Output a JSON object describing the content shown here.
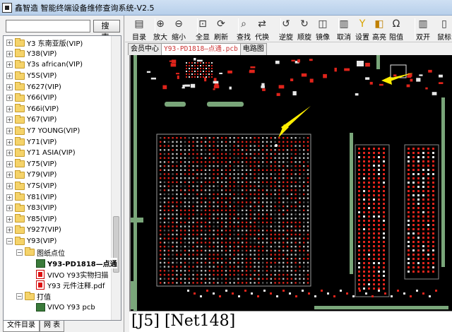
{
  "window": {
    "title": "鑫智造 智能终端设备维修查询系统-V2.5"
  },
  "search": {
    "button_label": "搜 索",
    "placeholder": ""
  },
  "tree": {
    "items": [
      {
        "label": "Y3 东南亚版(VIP)",
        "type": "folder",
        "expander": "+"
      },
      {
        "label": "Y38(VIP)",
        "type": "folder",
        "expander": "+"
      },
      {
        "label": "Y3s african(VIP)",
        "type": "folder",
        "expander": "+"
      },
      {
        "label": "Y5S(VIP)",
        "type": "folder",
        "expander": "+"
      },
      {
        "label": "Y627(VIP)",
        "type": "folder",
        "expander": "+"
      },
      {
        "label": "Y66(VIP)",
        "type": "folder",
        "expander": "+"
      },
      {
        "label": "Y66i(VIP)",
        "type": "folder",
        "expander": "+"
      },
      {
        "label": "Y67(VIP)",
        "type": "folder",
        "expander": "+"
      },
      {
        "label": "Y7 YOUNG(VIP)",
        "type": "folder",
        "expander": "+"
      },
      {
        "label": "Y71(VIP)",
        "type": "folder",
        "expander": "+"
      },
      {
        "label": "Y71 ASIA(VIP)",
        "type": "folder",
        "expander": "+"
      },
      {
        "label": "Y75(VIP)",
        "type": "folder",
        "expander": "+"
      },
      {
        "label": "Y79(VIP)",
        "type": "folder",
        "expander": "+"
      },
      {
        "label": "Y7S(VIP)",
        "type": "folder",
        "expander": "+"
      },
      {
        "label": "Y81(VIP)",
        "type": "folder",
        "expander": "+"
      },
      {
        "label": "Y83(VIP)",
        "type": "folder",
        "expander": "+"
      },
      {
        "label": "Y85(VIP)",
        "type": "folder",
        "expander": "+"
      },
      {
        "label": "Y927(VIP)",
        "type": "folder",
        "expander": "+"
      },
      {
        "label": "Y93(VIP)",
        "type": "folder",
        "expander": "−"
      },
      {
        "label": "图纸点位",
        "type": "folder",
        "expander": "−"
      },
      {
        "label": "Y93-PD1818—点通",
        "type": "pcb",
        "expander": ""
      },
      {
        "label": "VIVO Y93实物扫描",
        "type": "pdf",
        "expander": ""
      },
      {
        "label": "Y93 元件注释.pdf",
        "type": "pdf",
        "expander": ""
      },
      {
        "label": "打值",
        "type": "folder",
        "expander": "−"
      },
      {
        "label": "VIVO Y93 pcb",
        "type": "pcb",
        "expander": ""
      }
    ]
  },
  "left_tabs": [
    "文件目录",
    "网 表"
  ],
  "toolbar": {
    "buttons": [
      {
        "label": "目录",
        "icon": "book-icon"
      },
      {
        "label": "放大",
        "icon": "zoom-in-icon"
      },
      {
        "label": "缩小",
        "icon": "zoom-out-icon"
      },
      {
        "label": "全显",
        "icon": "fit-all-icon"
      },
      {
        "label": "刷新",
        "icon": "refresh-icon"
      },
      {
        "label": "查找",
        "icon": "find-icon"
      },
      {
        "label": "代换",
        "icon": "replace-icon"
      },
      {
        "label": "逆旋",
        "icon": "rotate-ccw-icon"
      },
      {
        "label": "顺旋",
        "icon": "rotate-cw-icon"
      },
      {
        "label": "镜像",
        "icon": "mirror-icon"
      },
      {
        "label": "取消",
        "icon": "cancel-icon"
      },
      {
        "label": "设置",
        "icon": "settings-icon"
      },
      {
        "label": "高亮",
        "icon": "highlight-icon"
      },
      {
        "label": "阻值",
        "icon": "resistance-icon"
      },
      {
        "label": "双开",
        "icon": "dual-open-icon"
      },
      {
        "label": "鼠标",
        "icon": "mouse-icon"
      }
    ]
  },
  "doc_tabs": [
    "会员中心",
    "Y93-PD1818—点通.pcb",
    "电路图"
  ],
  "status": {
    "text": "[J5] [Net148]"
  },
  "colors": {
    "pad_red": "#e0241b",
    "pad_white": "#e8e8e8",
    "board": "#000000",
    "trace_green": "#7aa67a",
    "arrow": "#ffee00"
  }
}
